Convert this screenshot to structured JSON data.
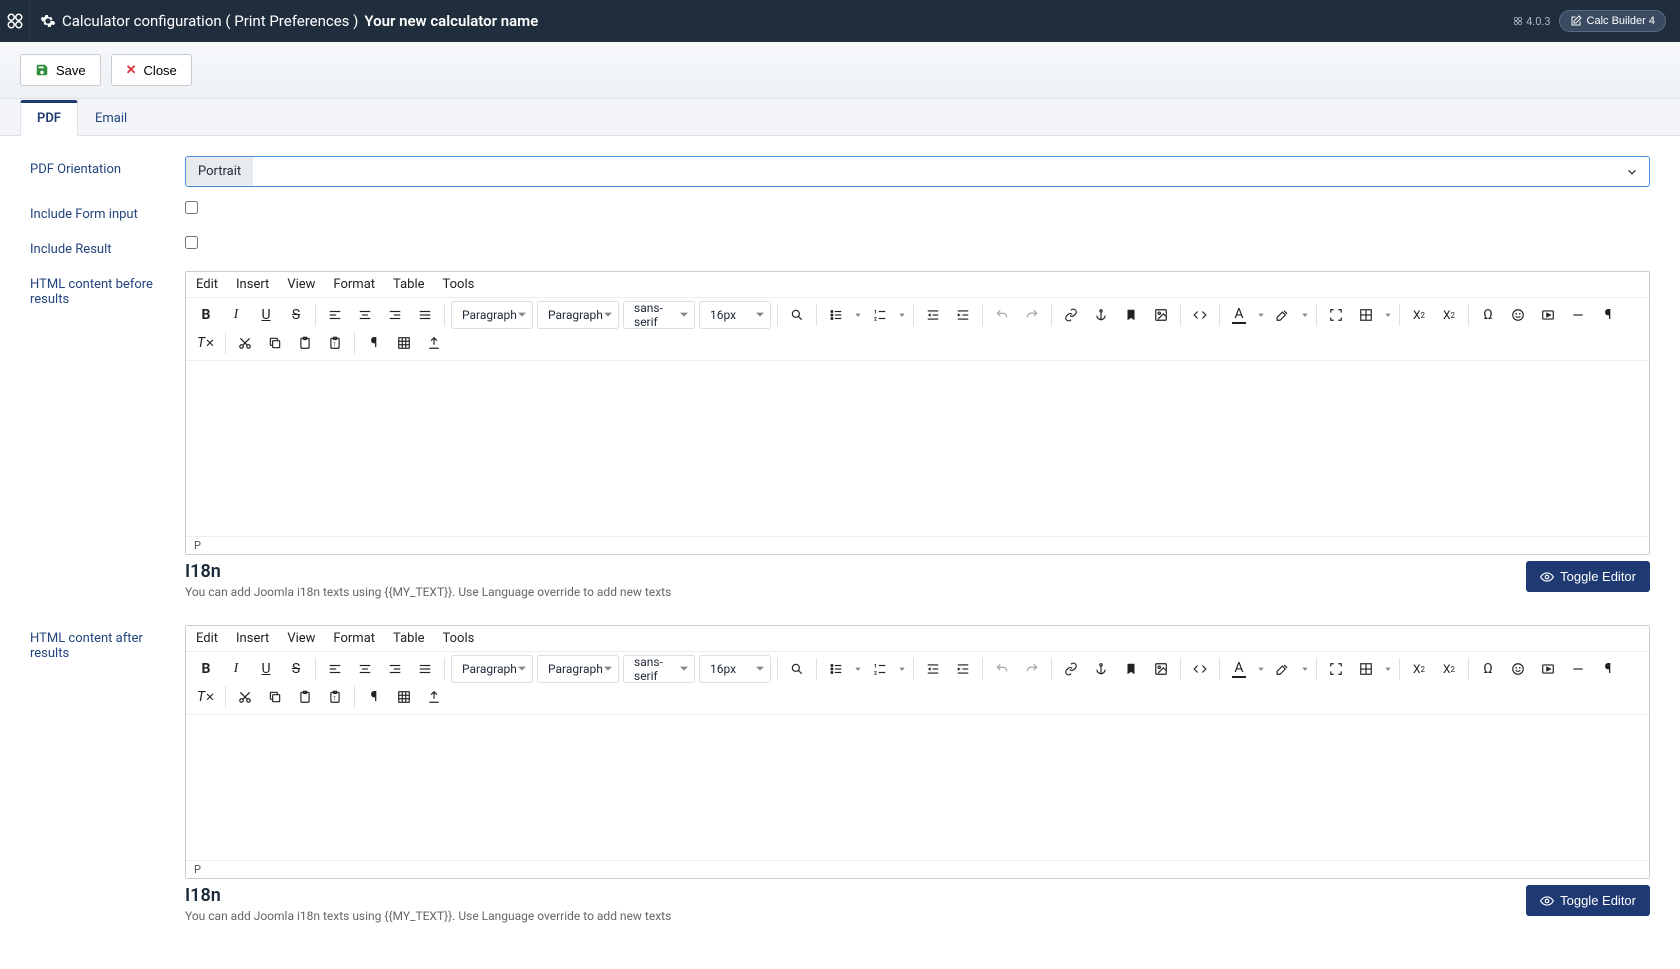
{
  "header": {
    "title_prefix": "Calculator configuration ( Print Preferences )",
    "title_name": "Your new calculator name",
    "version": "4.0.3",
    "product_button": "Calc Builder 4"
  },
  "toolbar": {
    "save_label": "Save",
    "close_label": "Close"
  },
  "tabs": {
    "pdf": "PDF",
    "email": "Email"
  },
  "form": {
    "orientation_label": "PDF Orientation",
    "orientation_value": "Portrait",
    "include_form_label": "Include Form input",
    "include_result_label": "Include Result",
    "before_label": "HTML content before results",
    "after_label": "HTML content after results"
  },
  "editor": {
    "menu": {
      "edit": "Edit",
      "insert": "Insert",
      "view": "View",
      "format": "Format",
      "table": "Table",
      "tools": "Tools"
    },
    "block_format": "Paragraph",
    "style_format": "Paragraph",
    "font_family": "sans-serif",
    "font_size": "16px",
    "status_path": "P"
  },
  "i18n": {
    "title": "I18n",
    "help": "You can add Joomla i18n texts using {{MY_TEXT}}. Use Language override to add new texts",
    "toggle_label": "Toggle Editor"
  }
}
